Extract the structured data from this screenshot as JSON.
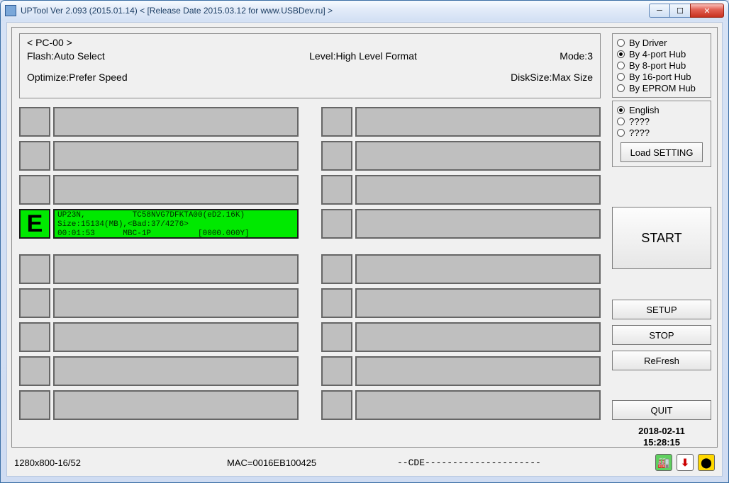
{
  "window": {
    "title": "UPTool Ver 2.093 (2015.01.14)         < [Release Date 2015.03.12 for www.USBDev.ru] >"
  },
  "info": {
    "pc": "< PC-00 >",
    "flash_label": "Flash:",
    "flash_value": "Auto Select",
    "level_label": "Level:",
    "level_value": "High Level Format",
    "mode_label": "Mode:",
    "mode_value": "3",
    "optimize_label": "Optimize:",
    "optimize_value": "Prefer Speed",
    "disksize_label": "DiskSize:",
    "disksize_value": "Max Size"
  },
  "hub": {
    "options": [
      "By Driver",
      "By 4-port Hub",
      "By 8-port Hub",
      "By 16-port Hub",
      "By EPROM Hub"
    ],
    "selected": 1
  },
  "lang": {
    "options": [
      "English",
      "????",
      "????"
    ],
    "selected": 0
  },
  "buttons": {
    "load": "Load SETTING",
    "start": "START",
    "setup": "SETUP",
    "stop": "STOP",
    "refresh": "ReFresh",
    "quit": "QUIT"
  },
  "datetime": {
    "date": "2018-02-11",
    "time": "15:28:15"
  },
  "active_slot": {
    "letter": "E",
    "line1": "UP23N,          TC58NVG7DFKTA00(eD2.16K)",
    "line2": "Size:15134(MB),<Bad:37/4276>",
    "line3": "00:01:53      MBC-1P          [0000.000Y]"
  },
  "footer": {
    "res": "1280x800-16/52",
    "mac": "MAC=0016EB100425",
    "cde": "--CDE---------------------"
  }
}
